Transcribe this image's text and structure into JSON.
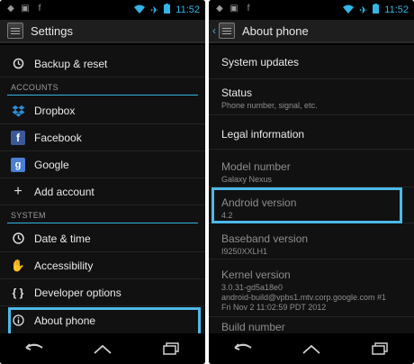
{
  "status_bar": {
    "time": "11:52"
  },
  "left": {
    "title": "Settings",
    "items_top": [
      {
        "label": "Backup & reset",
        "icon": "backup-icon"
      }
    ],
    "section_accounts": "ACCOUNTS",
    "accounts": [
      {
        "label": "Dropbox",
        "icon": "dropbox-icon"
      },
      {
        "label": "Facebook",
        "icon": "facebook-icon"
      },
      {
        "label": "Google",
        "icon": "google-icon"
      },
      {
        "label": "Add account",
        "icon": "plus-icon"
      }
    ],
    "section_system": "SYSTEM",
    "system": [
      {
        "label": "Date & time",
        "icon": "clock-icon"
      },
      {
        "label": "Accessibility",
        "icon": "hand-icon"
      },
      {
        "label": "Developer options",
        "icon": "braces-icon"
      },
      {
        "label": "About phone",
        "icon": "info-icon"
      }
    ]
  },
  "right": {
    "title": "About phone",
    "items": [
      {
        "title": "System updates"
      },
      {
        "title": "Status",
        "subtitle": "Phone number, signal, etc."
      },
      {
        "title": "Legal information"
      },
      {
        "title": "Model number",
        "subtitle": "Galaxy Nexus"
      },
      {
        "title": "Android version",
        "subtitle": "4.2"
      },
      {
        "title": "Baseband version",
        "subtitle": "I9250XXLH1"
      },
      {
        "title": "Kernel version",
        "subtitle_lines": [
          "3.0.31-gd5a18e0",
          "android-build@vpbs1.mtv.corp.google.com #1",
          "Fri Nov 2 11:02:59 PDT 2012"
        ]
      },
      {
        "title": "Build number"
      }
    ]
  },
  "colors": {
    "accent": "#33b5e5",
    "highlight": "#4db8e8"
  }
}
